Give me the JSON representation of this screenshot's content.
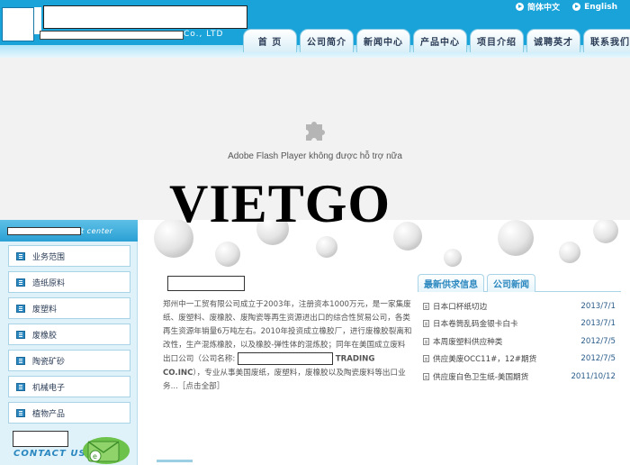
{
  "header": {
    "company_suffix": "Co., LTD",
    "languages": [
      {
        "label": "简体中文"
      },
      {
        "label": "English"
      }
    ]
  },
  "nav": {
    "tabs": [
      {
        "label": "首 页"
      },
      {
        "label": "公司简介"
      },
      {
        "label": "新闻中心"
      },
      {
        "label": "产品中心"
      },
      {
        "label": "项目介绍"
      },
      {
        "label": "诚聘英才"
      },
      {
        "label": "联系我们"
      }
    ]
  },
  "flash": {
    "icon": "puzzle-icon",
    "message": "Adobe Flash Player không được hỗ trợ nữa"
  },
  "watermark": "VIETGO",
  "sidebar": {
    "head_suffix": "t center",
    "items": [
      {
        "label": "业务范围"
      },
      {
        "label": "造纸原料"
      },
      {
        "label": "废塑料"
      },
      {
        "label": "废橡胶"
      },
      {
        "label": "陶瓷矿砂"
      },
      {
        "label": "机械电子"
      },
      {
        "label": "植物产品"
      }
    ],
    "contact_label": "CONTACT US"
  },
  "about": {
    "text_part1": "郑州中一工贸有限公司成立于2003年，注册资本1000万元，是一家集废纸、废塑料、废橡胶、废陶瓷等再生资源进出口的综合性贸易公司，各类再生资源年销量6万吨左右。2010年投资成立橡胶厂，进行废橡胶裂离和改性，生产混炼橡胶，以及橡胶-弹性体的混炼胶；同年在美国成立废料出口公司（公司名称:",
    "text_trading": "TRADING CO.INC",
    "text_part2": "），专业从事美国废纸，废塑料，废橡胶以及陶瓷废料等出口业务",
    "more_link": "...［点击全部］"
  },
  "news": {
    "tabs": [
      {
        "label": "最新供求信息"
      },
      {
        "label": "公司新闻"
      }
    ],
    "items": [
      {
        "title": "日本口杯纸切边",
        "date": "2013/7/1"
      },
      {
        "title": "日本卷筒乱码金银卡白卡",
        "date": "2013/7/1"
      },
      {
        "title": "本周废塑料供应种类",
        "date": "2012/7/5"
      },
      {
        "title": "供应美废OCC11#，12#期货",
        "date": "2012/7/5"
      },
      {
        "title": "供应废白色卫生纸-美国期货",
        "date": "2011/10/12"
      }
    ]
  },
  "colors": {
    "header_blue": "#1aa3d9",
    "accent_blue": "#2a87bf",
    "sidebar_bg": "#dff2fa"
  }
}
